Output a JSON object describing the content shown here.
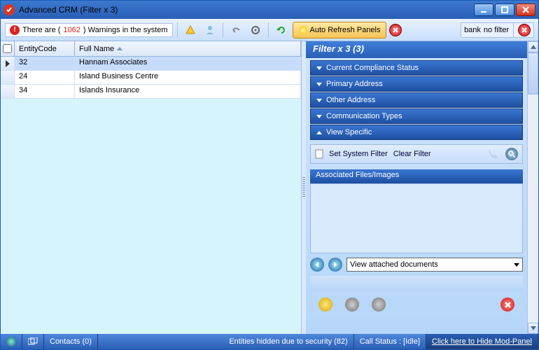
{
  "window": {
    "title": "Advanced CRM (Filter x 3)"
  },
  "toolbar": {
    "warning_prefix": "There are (",
    "warning_count": "1062",
    "warning_suffix": ") Warnings in the system",
    "autorefresh": "Auto Refresh Panels",
    "bank_label": "bank",
    "filter_label": "no filter"
  },
  "grid": {
    "col_entity": "EntityCode",
    "col_name": "Full Name",
    "rows": [
      {
        "code": "32",
        "name": "Hannam Associates"
      },
      {
        "code": "24",
        "name": "Island Business Centre"
      },
      {
        "code": "34",
        "name": "Islands Insurance"
      }
    ]
  },
  "filter": {
    "header": "Filter x 3 (3)",
    "sections": [
      "Current Compliance Status",
      "Primary Address",
      "Other Address",
      "Communication Types",
      "View Specific"
    ],
    "set_filter": "Set System Filter",
    "clear_filter": "Clear Filter",
    "assoc_header": "Associated Files/Images",
    "combo_value": "View attached documents"
  },
  "status": {
    "contacts": "Contacts (0)",
    "hidden": "Entities hidden due to security (82)",
    "call": "Call Status : [Idle]",
    "modpanel": "Click here to Hide Mod-Panel"
  }
}
